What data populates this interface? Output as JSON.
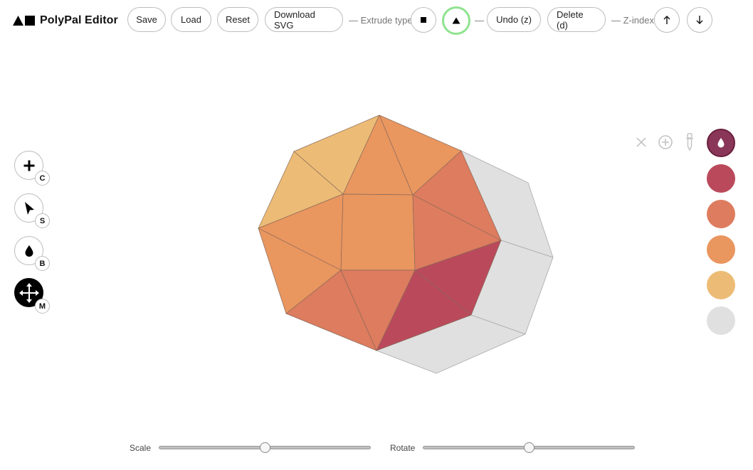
{
  "app": {
    "title": "PolyPal Editor"
  },
  "toolbar": {
    "save_label": "Save",
    "load_label": "Load",
    "reset_label": "Reset",
    "download_label": "Download SVG",
    "extrude_label": "— Extrude type",
    "extrude_square_icon": "square-icon",
    "extrude_triangle_icon": "triangle-icon",
    "extrude_selected": "triangle",
    "dash": "—",
    "undo_label": "Undo (z)",
    "delete_label": "Delete (d)",
    "zindex_label": "— Z-index",
    "up_icon": "arrow-up-icon",
    "down_icon": "arrow-down-icon"
  },
  "tools": [
    {
      "name": "create",
      "icon": "plus-icon",
      "hotkey": "C",
      "active": false
    },
    {
      "name": "select",
      "icon": "cursor-icon",
      "hotkey": "S",
      "active": false
    },
    {
      "name": "bucket",
      "icon": "droplet-icon",
      "hotkey": "B",
      "active": false
    },
    {
      "name": "move",
      "icon": "move-icon",
      "hotkey": "M",
      "active": true
    }
  ],
  "palette": {
    "actions": [
      "close-icon",
      "add-circle-icon",
      "eyedropper-icon"
    ],
    "selected_index": 0,
    "colors": [
      "#8a3659",
      "#ba4a5b",
      "#dd7c5e",
      "#e9965f",
      "#ecbc76",
      "#e0e0e0"
    ]
  },
  "sliders": {
    "scale_label": "Scale",
    "scale_value": 0.5,
    "rotate_label": "Rotate",
    "rotate_value": 0.5
  }
}
